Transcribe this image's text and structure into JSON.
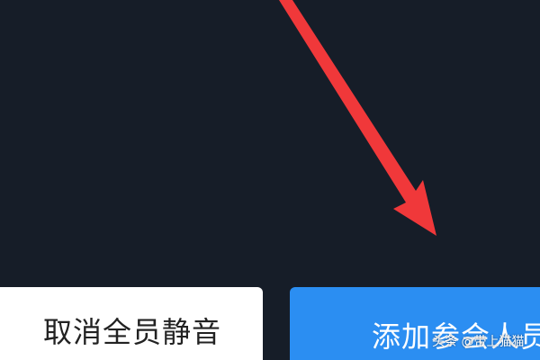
{
  "buttons": {
    "unmute_all_label": "取消全员静音",
    "add_participants_label": "添加参会人员"
  },
  "watermark": {
    "text": "头条 @带上猫猫"
  },
  "colors": {
    "background": "#161d28",
    "primary_button": "#2b8ef2",
    "secondary_button": "#ffffff",
    "annotation_arrow": "#f0383a"
  },
  "annotation": {
    "icon": "red-arrow-icon"
  }
}
